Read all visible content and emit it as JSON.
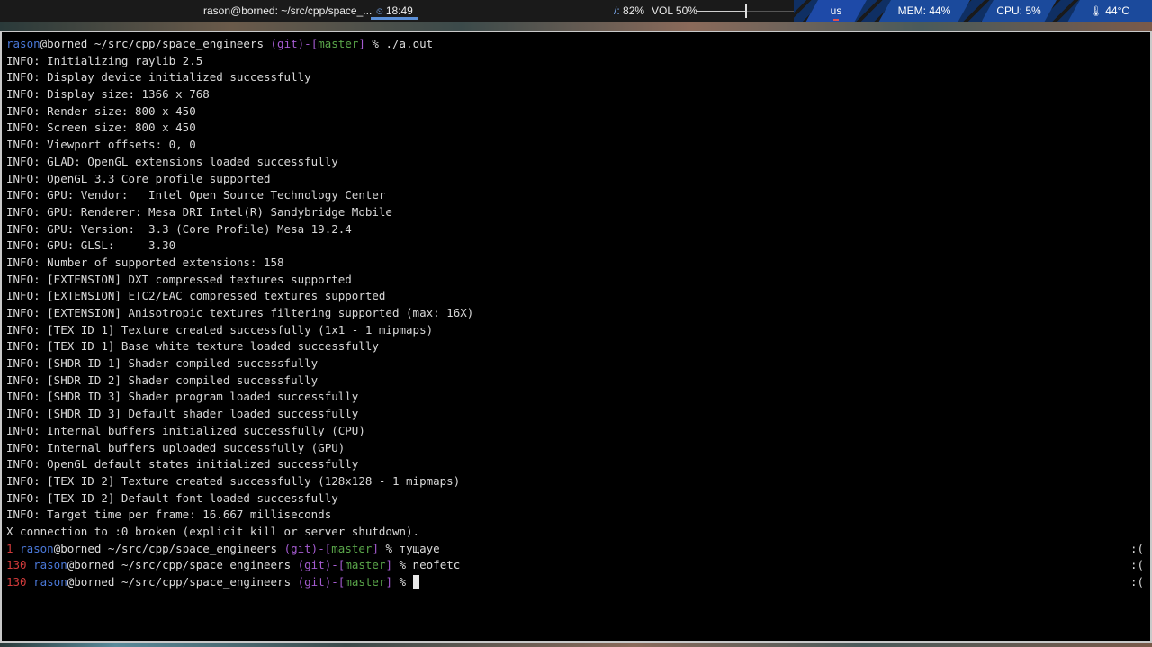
{
  "topbar": {
    "window_title": "rason@borned: ~/src/cpp/space_...",
    "clock": "18:49",
    "disk_label": "/:",
    "disk_value": "82%",
    "volume_label": "VOL 50%",
    "volume_level": 0.5,
    "keyboard_layout": "us",
    "memory": "MEM: 44%",
    "cpu": "CPU: 5%",
    "temp_icon": "thermometer-icon",
    "temperature": "44°C",
    "colors": {
      "accent": "#1b4a9c",
      "clock_underline": "#5b8fd6",
      "bar_bg": "#1a1a1a"
    }
  },
  "terminal": {
    "colors": {
      "background": "#000000",
      "user": "#4a78d8",
      "git_paren": "#a45bd0",
      "branch": "#5aa64a",
      "error_code": "#d03a3a"
    },
    "first_prompt": {
      "user": "rason",
      "host_path": "@borned ~/src/cpp/space_engineers ",
      "git": "(git)",
      "dash": "-",
      "branch_open": "[",
      "branch": "master",
      "branch_close": "]",
      "tail": " % ./a.out"
    },
    "output_lines": [
      "INFO: Initializing raylib 2.5",
      "INFO: Display device initialized successfully",
      "INFO: Display size: 1366 x 768",
      "INFO: Render size: 800 x 450",
      "INFO: Screen size: 800 x 450",
      "INFO: Viewport offsets: 0, 0",
      "INFO: GLAD: OpenGL extensions loaded successfully",
      "INFO: OpenGL 3.3 Core profile supported",
      "INFO: GPU: Vendor:   Intel Open Source Technology Center",
      "INFO: GPU: Renderer: Mesa DRI Intel(R) Sandybridge Mobile",
      "INFO: GPU: Version:  3.3 (Core Profile) Mesa 19.2.4",
      "INFO: GPU: GLSL:     3.30",
      "INFO: Number of supported extensions: 158",
      "INFO: [EXTENSION] DXT compressed textures supported",
      "INFO: [EXTENSION] ETC2/EAC compressed textures supported",
      "INFO: [EXTENSION] Anisotropic textures filtering supported (max: 16X)",
      "INFO: [TEX ID 1] Texture created successfully (1x1 - 1 mipmaps)",
      "INFO: [TEX ID 1] Base white texture loaded successfully",
      "INFO: [SHDR ID 1] Shader compiled successfully",
      "INFO: [SHDR ID 2] Shader compiled successfully",
      "INFO: [SHDR ID 3] Shader program loaded successfully",
      "INFO: [SHDR ID 3] Default shader loaded successfully",
      "INFO: Internal buffers initialized successfully (CPU)",
      "INFO: Internal buffers uploaded successfully (GPU)",
      "INFO: OpenGL default states initialized successfully",
      "INFO: [TEX ID 2] Texture created successfully (128x128 - 1 mipmaps)",
      "INFO: [TEX ID 2] Default font loaded successfully",
      "INFO: Target time per frame: 16.667 milliseconds",
      "X connection to :0 broken (explicit kill or server shutdown)."
    ],
    "error_prompts": [
      {
        "code": "1",
        "command": " % тущaуе",
        "rprompt": ":("
      },
      {
        "code": "130",
        "command": " % neofetc",
        "rprompt": ":("
      },
      {
        "code": "130",
        "command": " % ",
        "rprompt": ":("
      }
    ]
  }
}
